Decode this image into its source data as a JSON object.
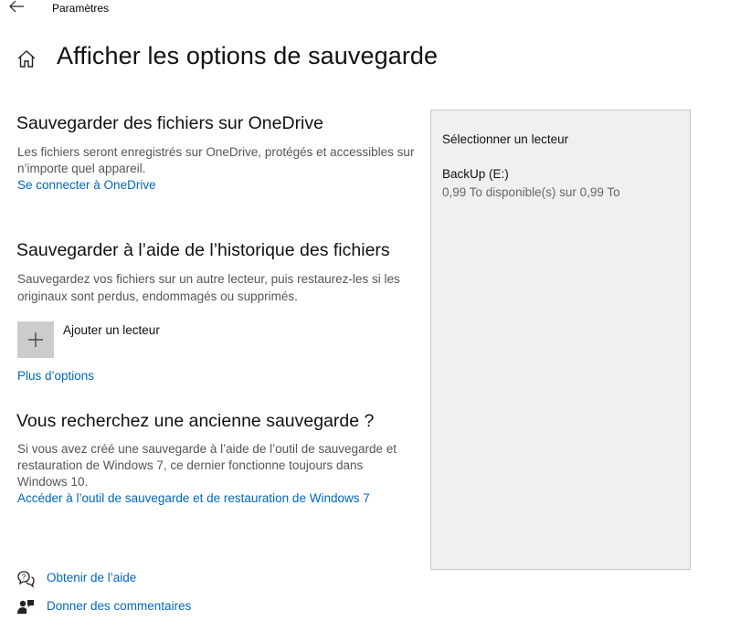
{
  "titlebar": {
    "title": "Paramètres"
  },
  "header": {
    "title": "Afficher les options de sauvegarde"
  },
  "onedrive": {
    "heading": "Sauvegarder des fichiers sur OneDrive",
    "line1": "Les fichiers seront enregistrés sur OneDrive, protégés et accessibles sur",
    "line2": "n’importe quel appareil.",
    "link": "Se connecter à OneDrive"
  },
  "history": {
    "heading": "Sauvegarder à l’aide de l’historique des fichiers",
    "line1": "Sauvegardez vos fichiers sur un autre lecteur, puis restaurez-les si les",
    "line2": "originaux sont perdus, endommagés ou supprimés.",
    "add_drive": "Ajouter un lecteur",
    "more_options": "Plus d’options"
  },
  "old_backup": {
    "heading": "Vous recherchez une ancienne sauvegarde ?",
    "line1": "Si vous avez créé une sauvegarde à l’aide de l’outil de sauvegarde et",
    "line2": "restauration de Windows 7, ce dernier fonctionne toujours dans",
    "line3": "Windows 10.",
    "link": "Accéder à l’outil de sauvegarde et de restauration de Windows 7"
  },
  "drive_panel": {
    "title": "Sélectionner un lecteur",
    "drives": [
      {
        "name": "BackUp (E:)",
        "space": "0,99 To disponible(s) sur 0,99 To"
      }
    ]
  },
  "footer": {
    "help": "Obtenir de l’aide",
    "feedback": "Donner des commentaires"
  },
  "colors": {
    "link": "#0067c0",
    "panel_bg": "#f0f0f0",
    "button_bg": "#cccccc"
  }
}
